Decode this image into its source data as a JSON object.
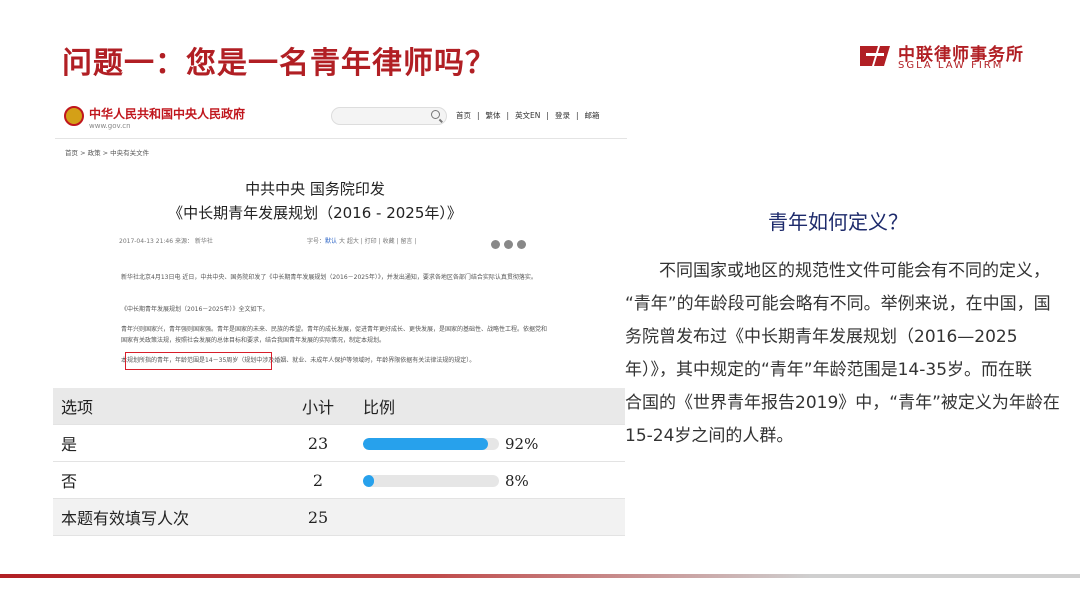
{
  "slide": {
    "title": "问题一：您是一名青年律师吗？",
    "logo_cn": "中联律师事务所",
    "logo_en": "SGLA LAW FIRM"
  },
  "webpage": {
    "site_name": "中华人民共和国中央人民政府",
    "domain": "www.gov.cn",
    "nav": [
      "首页",
      "|",
      "繁体",
      "|",
      "英文EN",
      "|",
      "登录",
      "|",
      "邮箱"
    ],
    "breadcrumb": "首页 > 政策 > 中央有关文件",
    "doc_title_1": "中共中央 国务院印发",
    "doc_title_2": "《中长期青年发展规划（2016 - 2025年）》",
    "meta_left": "2017-04-13 21:46 来源： 新华社",
    "meta_font_label": "字号：",
    "meta_font_default": "默认",
    "meta_font_rest": " 大 超大  |  打印  |  收藏  |  留言  |",
    "paragraphs": [
      "新华社北京4月13日电 近日，中共中央、国务院印发了《中长期青年发展规划（2016－2025年）》，并发出通知，要求各地区各部门结合实际认真贯彻落实。",
      "《中长期青年发展规划（2016－2025年）》全文如下。",
      "青年兴则国家兴，青年强则国家强。青年是国家的未来、民族的希望。青年的成长发展，促进青年更好成长、更快发展，是国家的基础性、战略性工程。依据党和国家有关政策法规，按照社会发展的总体目标和要求，结合我国青年发展的实际情况，制定本规划。",
      "本规划所指的青年，年龄范围是14－35周岁（规划中涉及婚姻、就业、未成年人保护等领域时，年龄界限依据有关法律法规的规定）。"
    ]
  },
  "survey": {
    "headers": [
      "选项",
      "小计",
      "比例"
    ],
    "rows": [
      {
        "option": "是",
        "count": "23",
        "percent": 92,
        "percent_label": "92%"
      },
      {
        "option": "否",
        "count": "2",
        "percent": 8,
        "percent_label": "8%"
      }
    ],
    "total_label": "本题有效填写人次",
    "total_count": "25"
  },
  "explanation": {
    "heading": "青年如何定义？",
    "lines": [
      "　　不同国家或地区的规范性文件可能会有不同的定义，",
      "“青年”的年龄段可能会略有不同。举例来说，在中国，国",
      "务院曾发布过《中长期青年发展规划（2016—2025",
      "年）》，其中规定的“青年”年龄范围是14-35岁。而在联",
      "合国的《世界青年报告2019》中，“青年”被定义为年龄在",
      "15-24岁之间的人群。"
    ]
  },
  "colors": {
    "brand_red": "#b11f24",
    "bar_blue": "#27a1ec",
    "heading_navy": "#1d2a6b"
  }
}
